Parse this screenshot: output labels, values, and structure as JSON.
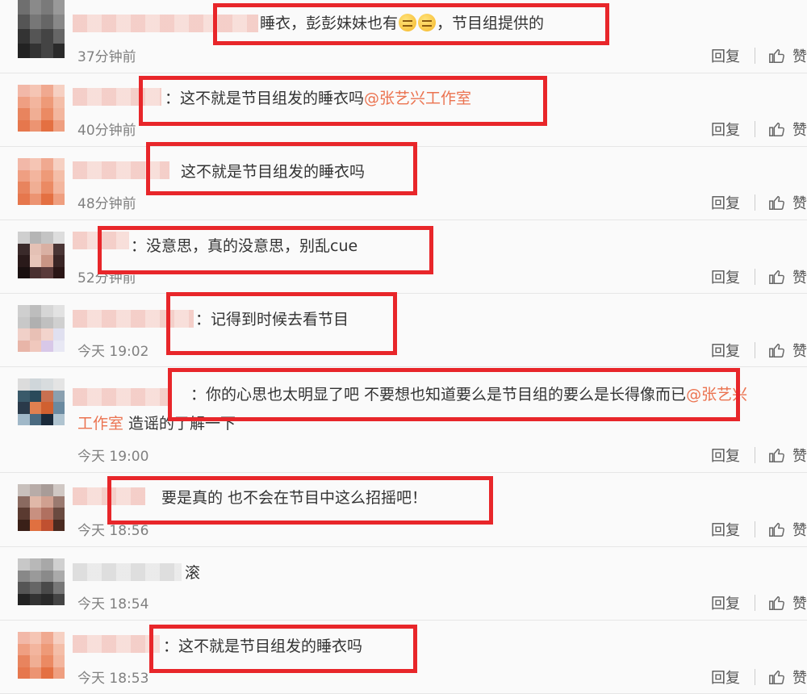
{
  "comments": [
    {
      "text_pre": "睡衣，彭彭妹妹也有",
      "text_post": "，节目组提供的",
      "emoji": [
        "unamused-face-icon",
        "unamused-face-icon"
      ],
      "time": "37分钟前"
    },
    {
      "prefix": "：",
      "text": "这不就是节目组发的睡衣吗",
      "mention": "@张艺兴工作室",
      "time": "40分钟前"
    },
    {
      "text": "这不就是节目组发的睡衣吗",
      "time": "48分钟前"
    },
    {
      "prefix": "：",
      "text": "没意思，真的没意思，别乱cue",
      "time": "52分钟前"
    },
    {
      "prefix": "：",
      "text": "记得到时候去看节目",
      "time": "今天 19:02"
    },
    {
      "prefix": "：",
      "text": "你的心思也太明显了吧 不要想也知道要么是节目组的要么是长得像而已",
      "mention": "@张艺兴",
      "continuation_mention": "工作室",
      "continuation_text": " 造谣的了解一下",
      "time": "今天 19:00"
    },
    {
      "text": "要是真的 也不会在节目中这么招摇吧！",
      "time": "今天 18:56"
    },
    {
      "text": "滚",
      "time": "今天 18:54"
    },
    {
      "prefix": "：",
      "text": "这不就是节目组发的睡衣吗",
      "time": "今天 18:53"
    }
  ],
  "actions": {
    "reply": "回复",
    "like": "赞"
  },
  "colors": {
    "highlight_box": "#e8262a",
    "mention": "#eb7350"
  }
}
